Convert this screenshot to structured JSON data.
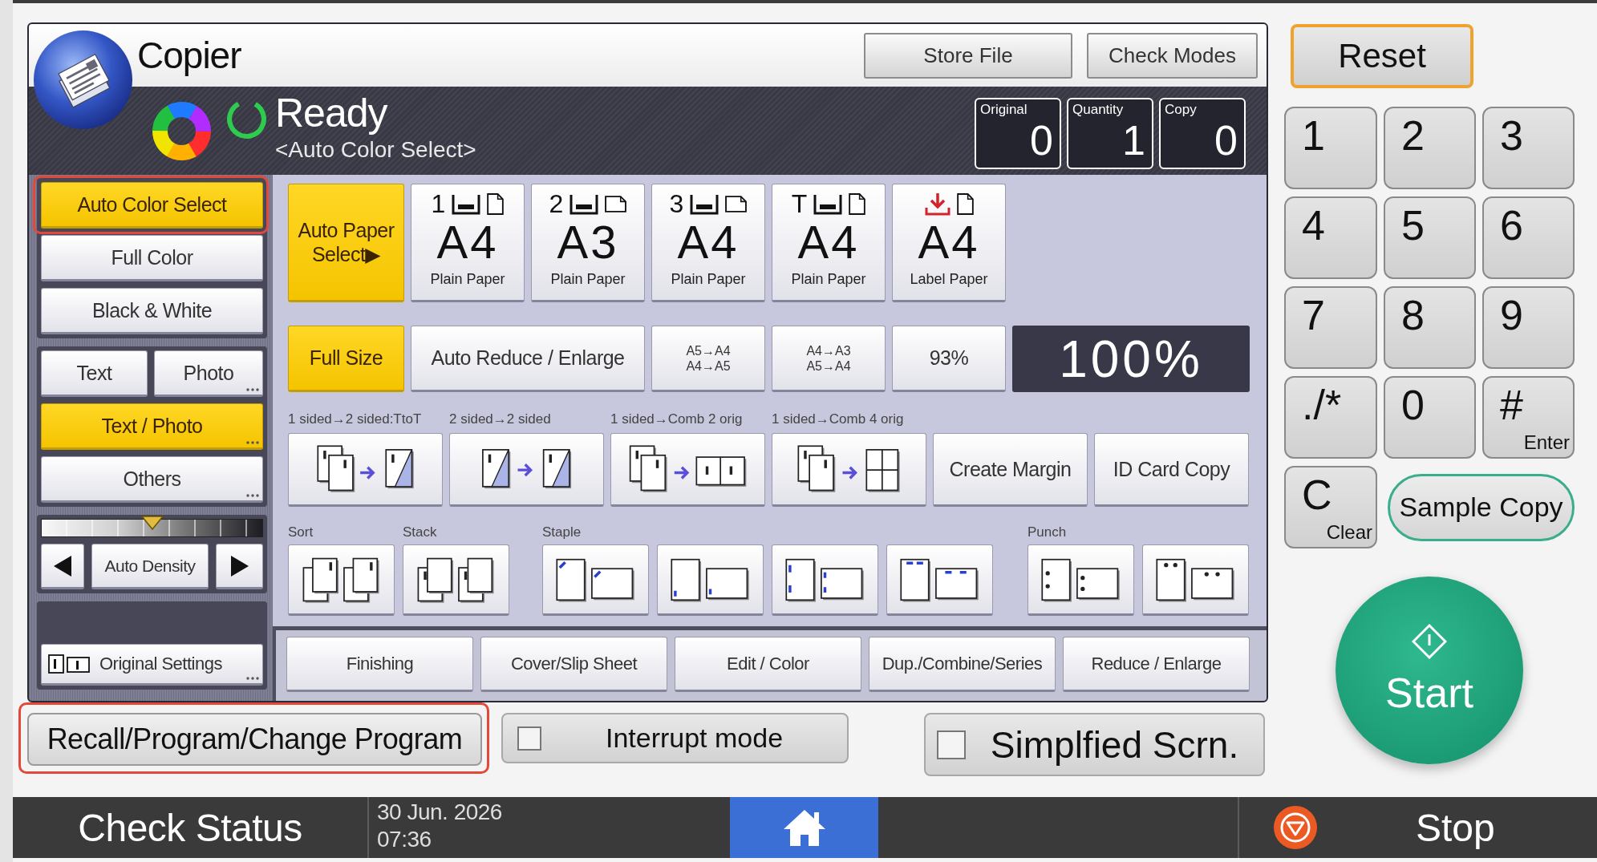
{
  "window": {
    "title": "Copier"
  },
  "header_buttons": [
    {
      "label": "Store File"
    },
    {
      "label": "Check Modes"
    }
  ],
  "status": {
    "state": "Ready",
    "mode": "<Auto Color Select>"
  },
  "counters": [
    {
      "label": "Original",
      "value": "0"
    },
    {
      "label": "Quantity",
      "value": "1"
    },
    {
      "label": "Copy",
      "value": "0"
    }
  ],
  "color_modes": [
    {
      "label": "Auto Color Select",
      "selected": true,
      "highlighted": true
    },
    {
      "label": "Full Color",
      "selected": false,
      "highlighted": false
    },
    {
      "label": "Black & White",
      "selected": false,
      "highlighted": false
    }
  ],
  "original_types": [
    {
      "label": "Text",
      "selected": false,
      "more": false
    },
    {
      "label": "Photo",
      "selected": false,
      "more": true
    },
    {
      "label": "Text / Photo",
      "selected": true,
      "more": true
    },
    {
      "label": "Others",
      "selected": false,
      "more": true
    }
  ],
  "density": {
    "label": "Auto Density",
    "level": 0.5
  },
  "original_settings": {
    "label": "Original Settings",
    "more": true
  },
  "paper_trays": [
    {
      "kind": "auto",
      "label": "Auto Paper Select▶",
      "selected": true
    },
    {
      "kind": "tray",
      "number": "1",
      "size": "A4",
      "paper_type": "Plain Paper",
      "landscape": false,
      "selected": false
    },
    {
      "kind": "tray",
      "number": "2",
      "size": "A3",
      "paper_type": "Plain Paper",
      "landscape": true,
      "selected": false
    },
    {
      "kind": "tray",
      "number": "3",
      "size": "A4",
      "paper_type": "Plain Paper",
      "landscape": true,
      "selected": false
    },
    {
      "kind": "tray",
      "number": "T",
      "size": "A4",
      "paper_type": "Plain Paper",
      "landscape": false,
      "selected": false
    },
    {
      "kind": "bypass",
      "size": "A4",
      "paper_type": "Label Paper",
      "landscape": false,
      "selected": false
    }
  ],
  "ratios": [
    {
      "kind": "text",
      "label": "Full Size",
      "selected": true
    },
    {
      "kind": "text",
      "label": "Auto Reduce / Enlarge",
      "selected": false
    },
    {
      "kind": "pair",
      "lines": [
        "A5→A4",
        "A4→A5"
      ],
      "selected": false
    },
    {
      "kind": "pair",
      "lines": [
        "A4→A3",
        "A5→A4"
      ],
      "selected": false
    },
    {
      "kind": "text",
      "label": "93%",
      "selected": false
    }
  ],
  "ratio_display": "100%",
  "duplex": [
    {
      "kind": "one_to_two",
      "caption": "1 sided→2 sided:TtoT",
      "selected": false
    },
    {
      "kind": "two_to_two",
      "caption": "2 sided→2 sided",
      "selected": false
    },
    {
      "kind": "comb_two",
      "caption": "1 sided→Comb 2 orig",
      "selected": false
    },
    {
      "kind": "comb_four",
      "caption": "1 sided→Comb 4 orig",
      "selected": false
    },
    {
      "kind": "text",
      "label": "Create Margin",
      "selected": false
    },
    {
      "kind": "text",
      "label": "ID Card Copy",
      "selected": false
    }
  ],
  "finishing": [
    {
      "caption": "Sort",
      "buttons": [
        {
          "kind": "sort",
          "selected": false
        }
      ]
    },
    {
      "caption": "Stack",
      "buttons": [
        {
          "kind": "stack",
          "selected": false
        }
      ]
    },
    {
      "caption": "Staple",
      "buttons": [
        {
          "kind": "staple_corner",
          "selected": false
        },
        {
          "kind": "staple_bottom",
          "selected": false
        },
        {
          "kind": "staple_left_double",
          "selected": false
        },
        {
          "kind": "staple_top_double",
          "selected": false
        }
      ]
    },
    {
      "caption": "Punch",
      "buttons": [
        {
          "kind": "punch_left",
          "selected": false
        },
        {
          "kind": "punch_top",
          "selected": false
        }
      ]
    }
  ],
  "feature_tabs": [
    {
      "label": "Finishing",
      "selected": false
    },
    {
      "label": "Cover/Slip Sheet",
      "selected": false
    },
    {
      "label": "Edit / Color",
      "selected": false
    },
    {
      "label": "Dup./Combine/Series",
      "selected": false
    },
    {
      "label": "Reduce / Enlarge",
      "selected": false
    }
  ],
  "program_button": {
    "label": "Recall/Program/Change Program",
    "highlighted": true
  },
  "mode_toggles": [
    {
      "label": "Interrupt mode",
      "checked": false
    },
    {
      "label": "Simplfied Scrn.",
      "checked": false
    }
  ],
  "keypad": {
    "reset": "Reset",
    "keys": [
      {
        "main": "1"
      },
      {
        "main": "2"
      },
      {
        "main": "3"
      },
      {
        "main": "4"
      },
      {
        "main": "5"
      },
      {
        "main": "6"
      },
      {
        "main": "7"
      },
      {
        "main": "8"
      },
      {
        "main": "9"
      },
      {
        "main": "./*"
      },
      {
        "main": "0"
      },
      {
        "main": "#",
        "sub": "Enter"
      },
      {
        "main": "C",
        "sub": "Clear"
      }
    ],
    "sample_copy": "Sample Copy",
    "start": "Start"
  },
  "status_bar": {
    "check_status": "Check Status",
    "date": "30 Jun. 2026",
    "time": "07:36",
    "stop": "Stop"
  }
}
